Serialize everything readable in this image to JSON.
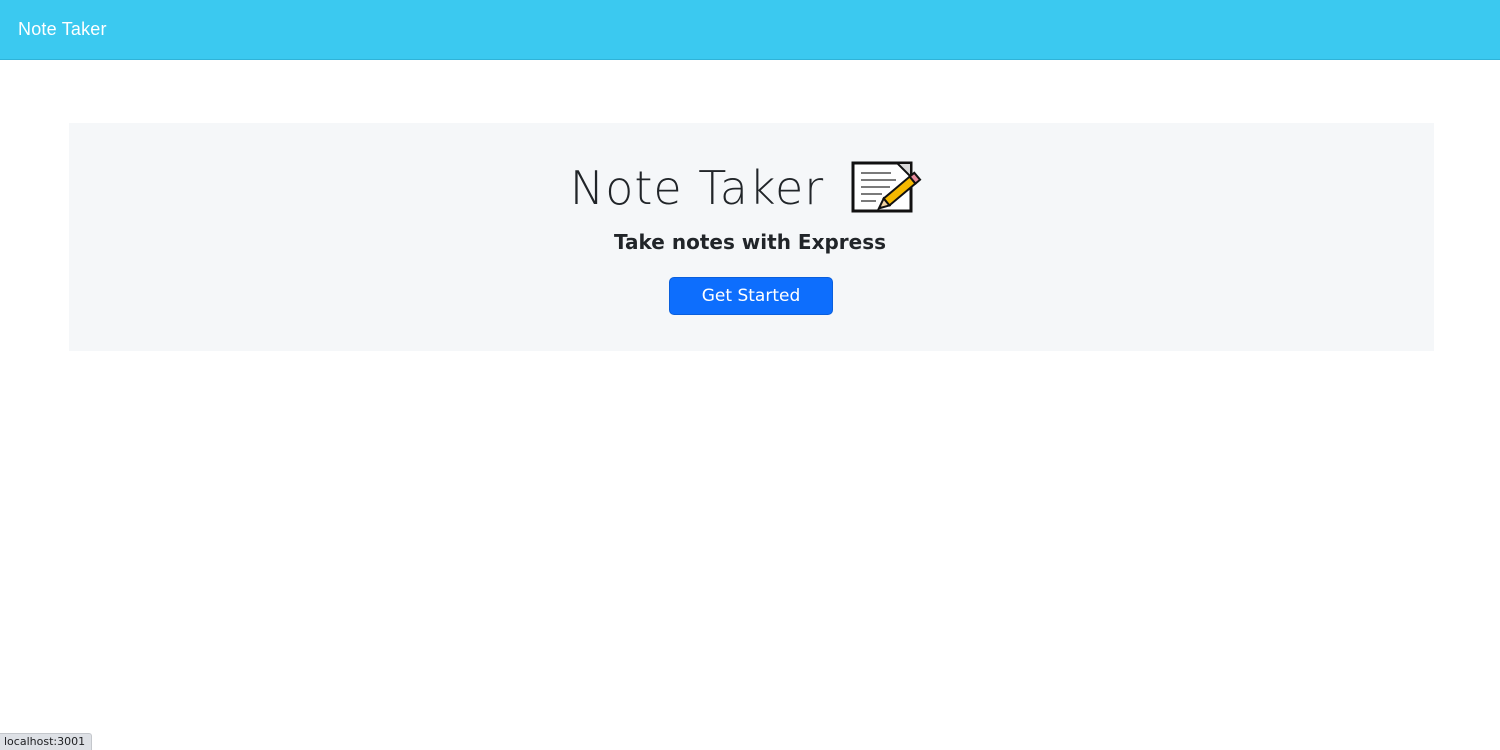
{
  "navbar": {
    "brand": "Note Taker",
    "background": "#3bc9f0"
  },
  "hero": {
    "title": "Note Taker",
    "title_icon": "memo-icon",
    "subtitle": "Take notes with Express",
    "cta_label": "Get Started",
    "cta_color": "#0d6efd"
  },
  "status_bar": {
    "url": "localhost:3001"
  }
}
